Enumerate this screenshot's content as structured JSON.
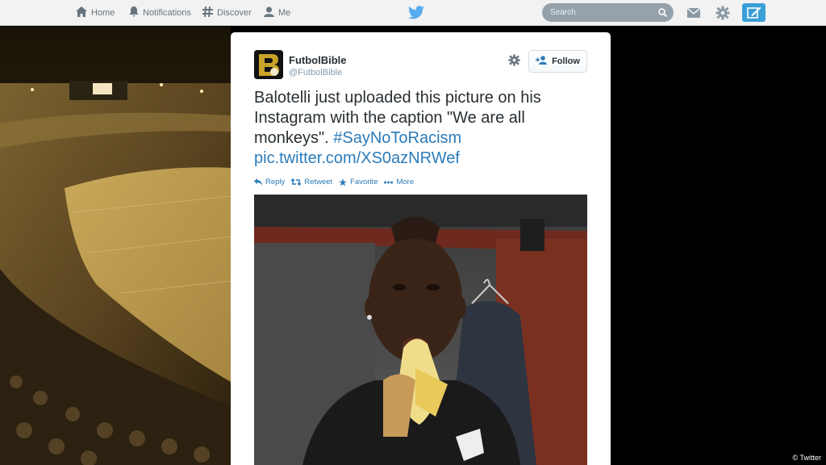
{
  "nav": {
    "home": "Home",
    "notifications": "Notifications",
    "discover": "Discover",
    "me": "Me",
    "search_placeholder": "Search"
  },
  "tweet": {
    "fullname": "FutbolBible",
    "handle": "@FutbolBible",
    "follow_label": "Follow",
    "text_plain": "Balotelli just uploaded this picture on his Instagram with the caption \"We are all monkeys\".",
    "hashtag": "#SayNoToRacism",
    "link": "pic.twitter.com/XS0azNRWef",
    "actions": {
      "reply": "Reply",
      "retweet": "Retweet",
      "favorite": "Favorite",
      "more": "More"
    }
  },
  "credit": "© Twitter",
  "colors": {
    "link": "#2b7bb9",
    "compose": "#3a9fd6"
  },
  "icons": [
    "home-icon",
    "bell-icon",
    "hashtag-icon",
    "person-icon",
    "twitter-bird-icon",
    "search-icon",
    "envelope-icon",
    "gear-icon",
    "compose-icon",
    "follow-person-icon",
    "reply-icon",
    "retweet-icon",
    "star-icon",
    "more-dots-icon"
  ]
}
